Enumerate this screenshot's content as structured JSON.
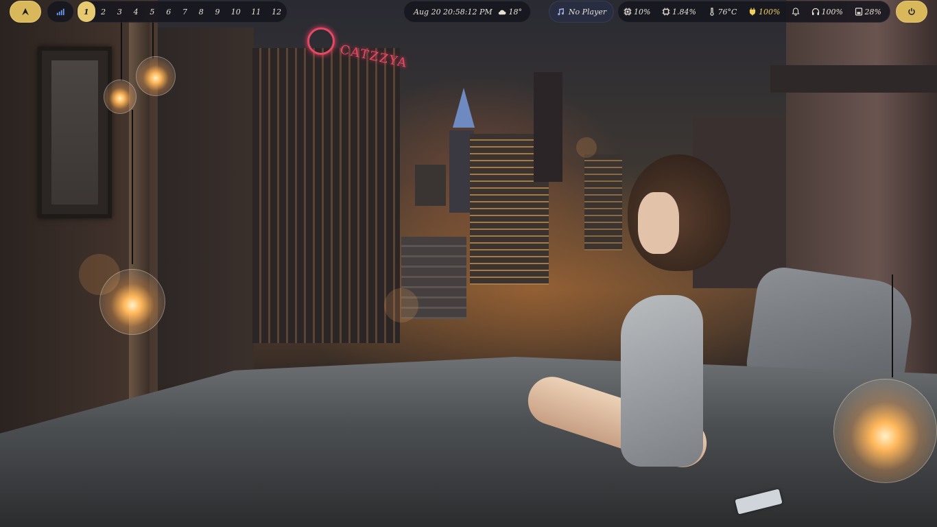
{
  "launcher": {
    "icon": "arch-logo-icon"
  },
  "network": {
    "icon": "wifi-signal-icon"
  },
  "workspaces": {
    "active": "1",
    "items": [
      "1",
      "2",
      "3",
      "4",
      "5",
      "6",
      "7",
      "8",
      "9",
      "10",
      "11",
      "12"
    ]
  },
  "clock": {
    "datetime": "Aug 20 20:58:12 PM"
  },
  "weather": {
    "icon": "cloud-icon",
    "temperature": "18°"
  },
  "player": {
    "icon": "music-note-icon",
    "label": "No Player"
  },
  "stats": {
    "cpu": {
      "icon": "cpu-icon",
      "value": "10%"
    },
    "memory": {
      "icon": "chip-icon",
      "value": "1.84%"
    },
    "temperature": {
      "icon": "thermometer-icon",
      "value": "76°C"
    },
    "battery": {
      "icon": "plug-icon",
      "value": "100%"
    },
    "notifications": {
      "icon": "bell-icon"
    },
    "volume": {
      "icon": "headphones-icon",
      "value": "100%"
    },
    "disk": {
      "icon": "disk-icon",
      "value": "28%"
    }
  },
  "power": {
    "icon": "power-icon"
  },
  "colors": {
    "accent": "#e6c970",
    "bar_bg": "#16161e",
    "text": "#e6e0d4",
    "warn": "#f0cf5d"
  }
}
